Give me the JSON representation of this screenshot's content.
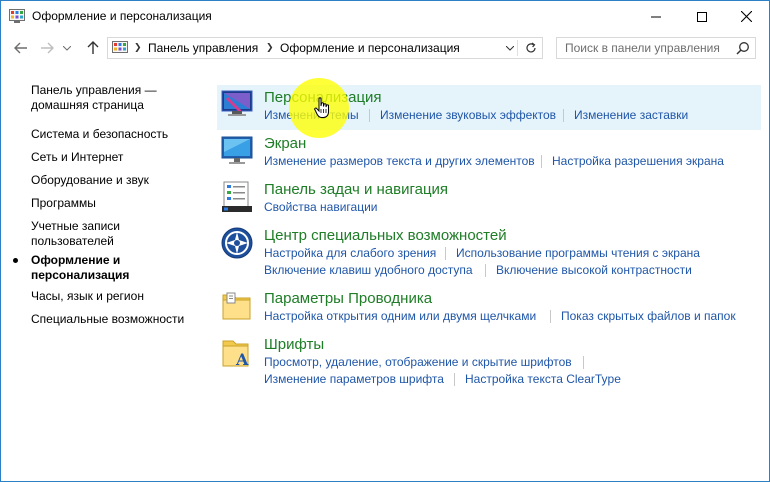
{
  "window": {
    "title": "Оформление и персонализация"
  },
  "address": {
    "crumbs": [
      "Панель управления",
      "Оформление и персонализация"
    ]
  },
  "search": {
    "placeholder": "Поиск в панели управления"
  },
  "sidebar": {
    "items": [
      "Панель управления —",
      "домашняя страница",
      "Система и безопасность",
      "Сеть и Интернет",
      "Оборудование и звук",
      "Программы",
      "Учетные записи",
      "пользователей",
      "Оформление и",
      "персонализация",
      "Часы, язык и регион",
      "Специальные возможности"
    ]
  },
  "categories": [
    {
      "title": "Персонализация",
      "icon": "personalization-icon",
      "links": [
        "Изменение темы",
        "Изменение звуковых эффектов",
        "Изменение заставки"
      ]
    },
    {
      "title": "Экран",
      "icon": "display-icon",
      "links": [
        "Изменение размеров текста и других элементов",
        "Настройка разрешения экрана"
      ]
    },
    {
      "title": "Панель задач и навигация",
      "icon": "taskbar-icon",
      "links": [
        "Свойства навигации"
      ]
    },
    {
      "title": "Центр специальных возможностей",
      "icon": "ease-of-access-icon",
      "links": [
        "Настройка для слабого зрения",
        "Использование программы чтения с экрана",
        "Включение клавиш удобного доступа",
        "Включение высокой контрастности"
      ]
    },
    {
      "title": "Параметры Проводника",
      "icon": "folder-options-icon",
      "links": [
        "Настройка открытия одним или двумя щелчками",
        "Показ скрытых файлов и папок"
      ]
    },
    {
      "title": "Шрифты",
      "icon": "fonts-icon",
      "links": [
        "Просмотр, удаление, отображение и скрытие шрифтов",
        "Изменение параметров шрифта",
        "Настройка текста ClearType"
      ]
    }
  ],
  "colors": {
    "title_green": "#1e7d26",
    "link_blue": "#1f56a8",
    "hover_bg": "#e5f3fb",
    "cursor_highlight": "#ffff00"
  }
}
